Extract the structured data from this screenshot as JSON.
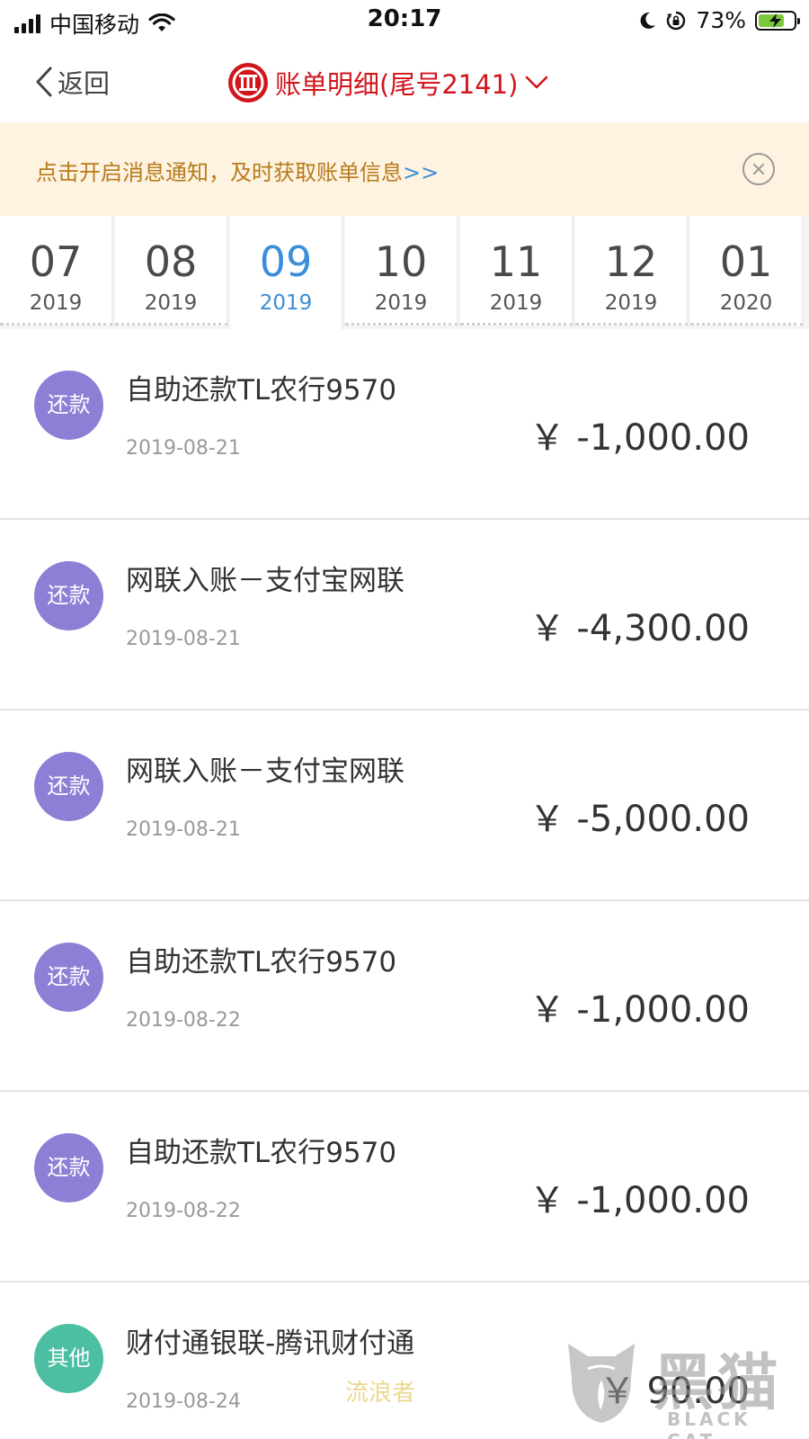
{
  "status_bar": {
    "carrier": "中国移动",
    "time": "20:17",
    "battery_percent": "73%",
    "battery_level": 0.73,
    "icons": [
      "signal-icon",
      "wifi-icon",
      "moon-icon",
      "rotation-lock-icon",
      "battery-charging-icon"
    ]
  },
  "nav": {
    "back_label": "返回",
    "title": "账单明细(尾号2141)",
    "logo_icon": "citic-bank-logo-icon",
    "title_color": "#d0151b"
  },
  "notice": {
    "text": "点击开启消息通知，及时获取账单信息",
    "link": ">>"
  },
  "months": [
    {
      "month": "07",
      "year": "2019",
      "active": false
    },
    {
      "month": "08",
      "year": "2019",
      "active": false
    },
    {
      "month": "09",
      "year": "2019",
      "active": true
    },
    {
      "month": "10",
      "year": "2019",
      "active": false
    },
    {
      "month": "11",
      "year": "2019",
      "active": false
    },
    {
      "month": "12",
      "year": "2019",
      "active": false
    },
    {
      "month": "01",
      "year": "2020",
      "active": false
    }
  ],
  "active_color": "#3a8fd8",
  "transactions": [
    {
      "badge": "还款",
      "badge_color": "#8e7fd6",
      "title": "自助还款TL农行9570",
      "date": "2019-08-21",
      "amount": "￥ -1,000.00"
    },
    {
      "badge": "还款",
      "badge_color": "#8e7fd6",
      "title": "网联入账－支付宝网联",
      "date": "2019-08-21",
      "amount": "￥ -4,300.00"
    },
    {
      "badge": "还款",
      "badge_color": "#8e7fd6",
      "title": "网联入账－支付宝网联",
      "date": "2019-08-21",
      "amount": "￥ -5,000.00"
    },
    {
      "badge": "还款",
      "badge_color": "#8e7fd6",
      "title": "自助还款TL农行9570",
      "date": "2019-08-22",
      "amount": "￥ -1,000.00"
    },
    {
      "badge": "还款",
      "badge_color": "#8e7fd6",
      "title": "自助还款TL农行9570",
      "date": "2019-08-22",
      "amount": "￥ -1,000.00"
    },
    {
      "badge": "其他",
      "badge_color": "#4cbfa3",
      "title": "财付通银联-腾讯财付通",
      "date": "2019-08-24",
      "amount": "￥ 90.00"
    }
  ],
  "watermark": {
    "title": "黑猫",
    "subtitle": "BLACK CAT",
    "user": "流浪者"
  }
}
